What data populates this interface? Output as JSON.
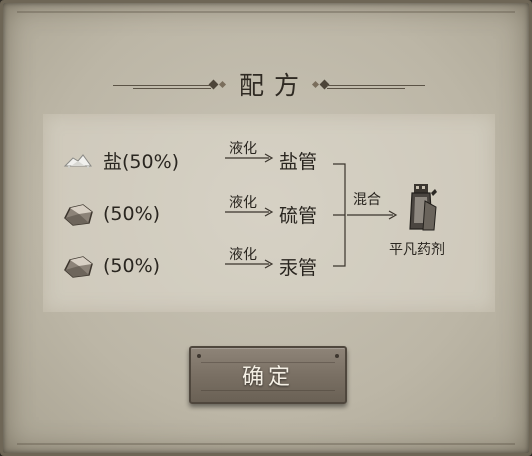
{
  "dialog": {
    "title": "配方",
    "ingredients": [
      {
        "icon": "salt-icon",
        "label": "盐(50%)",
        "process": "液化",
        "product": "盐管"
      },
      {
        "icon": "ore-icon",
        "label": "(50%)",
        "process": "液化",
        "product": "硫管"
      },
      {
        "icon": "ore-icon",
        "label": "(50%)",
        "process": "液化",
        "product": "汞管"
      }
    ],
    "mix_label": "混合",
    "result": {
      "icon": "potion-icon",
      "label": "平凡药剂"
    },
    "confirm_label": "确定"
  }
}
